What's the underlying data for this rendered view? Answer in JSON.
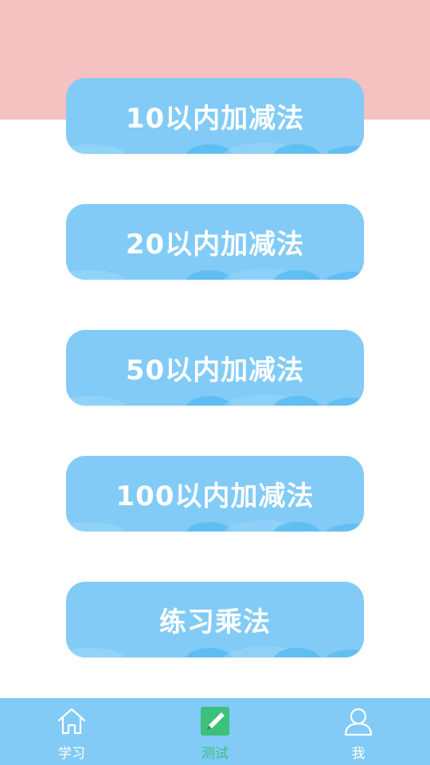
{
  "menu": {
    "items": [
      {
        "label": "10以内加减法"
      },
      {
        "label": "20以内加减法"
      },
      {
        "label": "50以内加减法"
      },
      {
        "label": "100以内加减法"
      },
      {
        "label": "练习乘法"
      }
    ]
  },
  "tabs": {
    "study": {
      "label": "学习",
      "icon": "home-icon"
    },
    "test": {
      "label": "测试",
      "icon": "pencil-icon"
    },
    "me": {
      "label": "我",
      "icon": "user-icon"
    }
  },
  "colors": {
    "header_band": "#f6c1c1",
    "button": "#82cbf7",
    "tabbar": "#82cbf7",
    "active_tab": "#3cc07a"
  }
}
